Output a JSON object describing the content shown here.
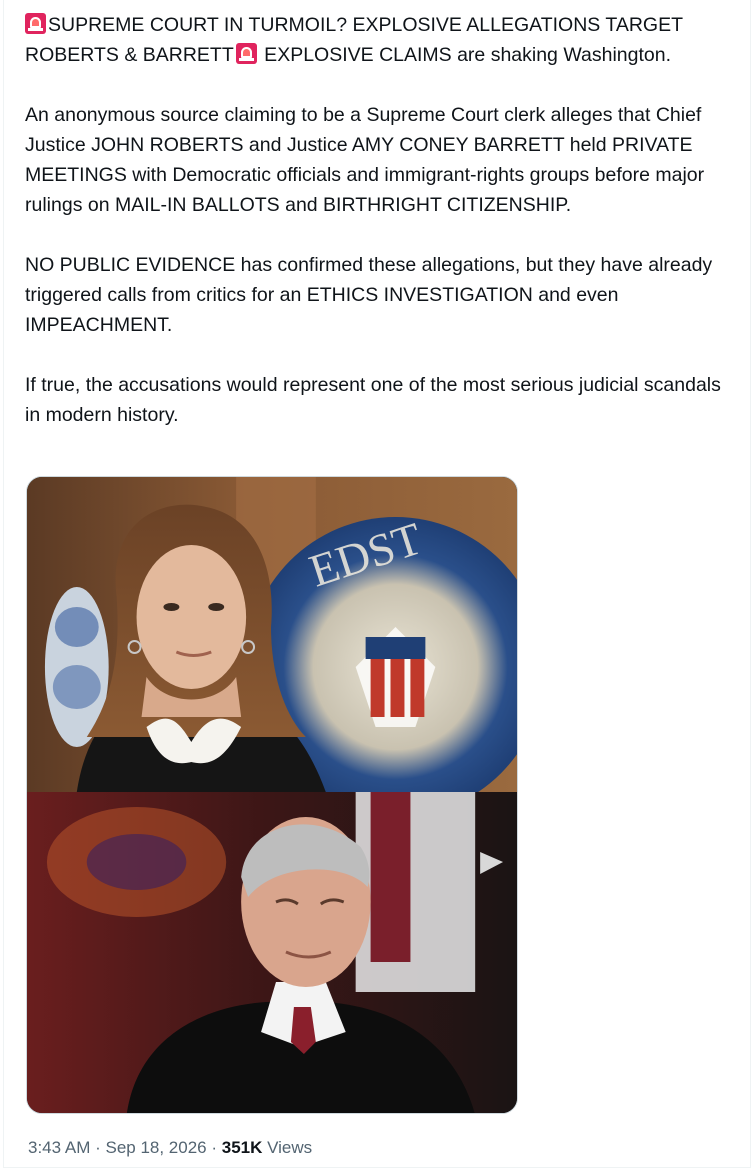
{
  "post": {
    "paragraphs": {
      "p1": {
        "text_a": "SUPREME COURT IN TURMOIL? EXPLOSIVE ALLEGATIONS TARGET ROBERTS & BARRETT",
        "text_b": " EXPLOSIVE CLAIMS are shaking Washington."
      },
      "p2": "An anonymous source claiming to be a Supreme Court clerk alleges that Chief Justice JOHN ROBERTS and Justice AMY CONEY BARRETT held PRIVATE MEETINGS with Democratic officials and immigrant-rights groups before major rulings on MAIL-IN BALLOTS and BIRTHRIGHT CITIZENSHIP.",
      "p3": "NO PUBLIC EVIDENCE has confirmed these allegations, but they have already triggered calls from critics for an ETHICS INVESTIGATION and even IMPEACHMENT.",
      "p4": "If true, the accusations would represent one of the most serious judicial scandals in modern history."
    },
    "emoji": "police-car-light-icon",
    "media": {
      "top_image": "photo of woman in judicial robe before a seal",
      "bottom_image": "photo of man in judicial robe"
    },
    "meta": {
      "time": "3:43 AM",
      "separator": " · ",
      "date": "Sep 18, 2026",
      "views_count": "351K",
      "views_label": " Views"
    }
  },
  "colors": {
    "text": "#0f1419",
    "secondary": "#536471",
    "border": "#cfd9de",
    "siren": "#e0245e"
  }
}
